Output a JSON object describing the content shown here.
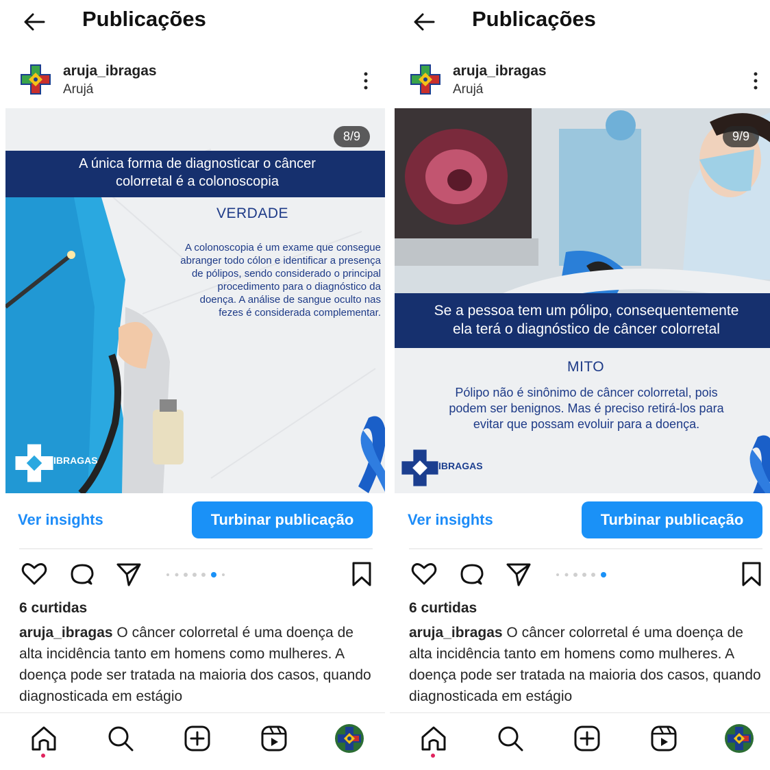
{
  "header": {
    "title": "Publicações"
  },
  "account": {
    "username": "aruja_ibragas",
    "location": "Arujá"
  },
  "panels": [
    {
      "counter": "8/9",
      "banner_line1": "A única forma de diagnosticar o câncer",
      "banner_line2": "colorretal é a colonoscopia",
      "verdict": "VERDADE",
      "body_lines": [
        "A colonoscopia é um exame que consegue",
        "abranger todo cólon e identificar a presença",
        "de pólipos, sendo considerado o principal",
        "procedimento para o diagnóstico da",
        "doença. A análise de sangue oculto nas",
        "fezes é considerada complementar."
      ],
      "logo_text": "IBRAGAS",
      "active_dot": 5
    },
    {
      "counter": "9/9",
      "banner_line1": "Se a pessoa tem um pólipo, consequentemente",
      "banner_line2": "ela terá o diagnóstico de câncer colorretal",
      "verdict": "MITO",
      "body_lines": [
        "Pólipo não é sinônimo de câncer colorretal, pois",
        "podem ser benignos. Mas é preciso retirá-los para",
        "evitar que possam evoluir para a doença."
      ],
      "logo_text": "IBRAGAS",
      "active_dot": 6
    }
  ],
  "actions": {
    "insights_label": "Ver insights",
    "boost_label": "Turbinar publicação"
  },
  "likes": "6 curtidas",
  "caption": {
    "author": "aruja_ibragas",
    "text": "O câncer colorretal é uma doença de alta incidência tanto em homens como mulheres. A doença pode ser tratada na maioria dos casos, quando diagnosticada em estágio"
  },
  "icons": {
    "back": "arrow-left-icon",
    "more": "kebab-menu-icon",
    "like": "heart-icon",
    "comment": "comment-icon",
    "share": "send-icon",
    "save": "bookmark-icon",
    "nav": [
      "home-icon",
      "search-icon",
      "add-post-icon",
      "reels-icon",
      "profile-avatar"
    ]
  },
  "colors": {
    "accent": "#1a91f7",
    "banner": "#16306e",
    "post_text": "#1d3a87",
    "notification": "#e0245e"
  }
}
